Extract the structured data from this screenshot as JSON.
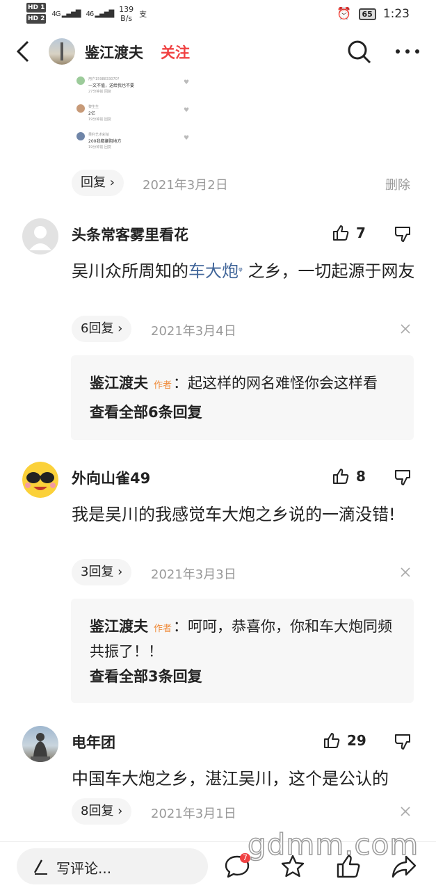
{
  "status_bar": {
    "hd1": "HD 1",
    "hd2": "HD 2",
    "signal1": "4G",
    "signal2": "46",
    "speed_value": "139",
    "speed_unit": "B/s",
    "battery": "65",
    "time": "1:23"
  },
  "header": {
    "author_name": "鉴江渡夫",
    "follow_label": "关注"
  },
  "screenshot_thumb": {
    "rows": [
      {
        "user": "用户1598833070?",
        "text": "一文不值，送给我也不要",
        "meta": "27分钟前  回复"
      },
      {
        "user": "黎生生",
        "text": "2亿",
        "meta": "19分钟前  回复"
      },
      {
        "user": "果利艺术彩绘",
        "text": "200我都嫌阻地方",
        "meta": "19分钟前  回复"
      }
    ]
  },
  "top_reply": {
    "reply_label": "回复 ›",
    "date": "2021年3月2日",
    "delete_label": "删除"
  },
  "comments": [
    {
      "name": "头条常客雾里看花",
      "likes": "7",
      "text_before": "吴川众所周知的",
      "link_text": "车大炮",
      "text_after": " 之乡，一切起源于网友",
      "reply_label": "6回复 ›",
      "date": "2021年3月4日",
      "sub_author": "鉴江渡夫",
      "author_tag": "作者",
      "sub_text": "：起这样的网名难怪你会这样看",
      "view_all": "查看全部6条回复"
    },
    {
      "name": "外向山雀49",
      "likes": "8",
      "text": "我是吴川的我感觉车大炮之乡说的一滴没错!",
      "reply_label": "3回复 ›",
      "date": "2021年3月3日",
      "sub_author": "鉴江渡夫",
      "author_tag": "作者",
      "sub_text": "：呵呵，恭喜你，你和车大炮同频共振了！！",
      "view_all": "查看全部3条回复"
    },
    {
      "name": "电年团",
      "likes": "29",
      "text": "中国车大炮之乡，湛江吴川，这个是公认的",
      "reply_label": "8回复 ›",
      "date": "2021年3月1日"
    }
  ],
  "bottom_bar": {
    "input_placeholder": "写评论...",
    "comment_badge": "7",
    "watermark": "gdmm.com"
  }
}
